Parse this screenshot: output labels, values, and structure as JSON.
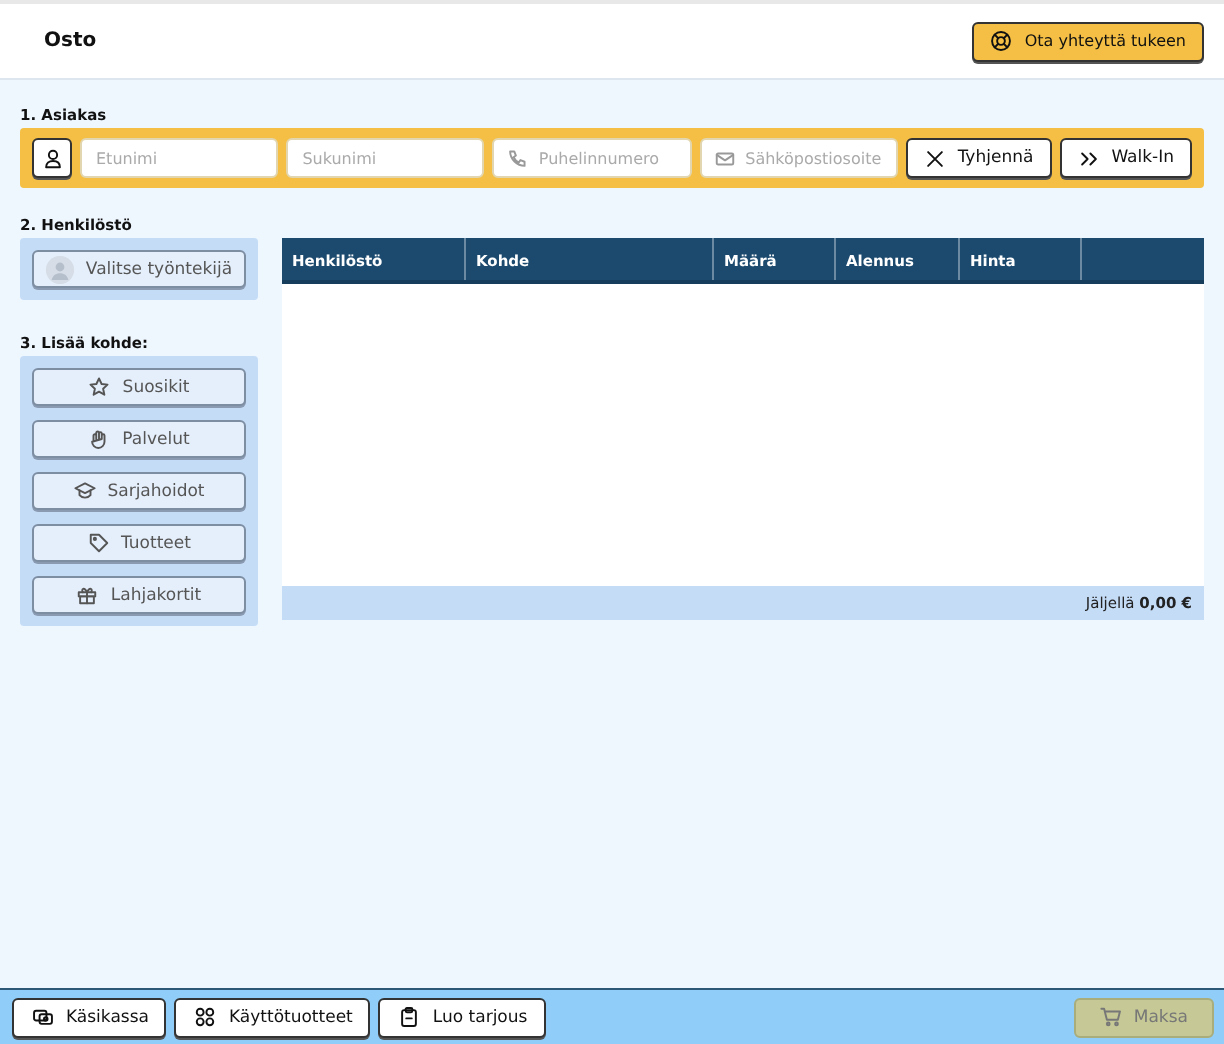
{
  "header": {
    "title": "Osto",
    "support_button": "Ota yhteyttä tukeen"
  },
  "customer": {
    "heading": "1. Asiakas",
    "fields": [
      {
        "placeholder": "Etunimi"
      },
      {
        "placeholder": "Sukunimi"
      },
      {
        "placeholder": "Puhelinnumero"
      },
      {
        "placeholder": "Sähköpostiosoite"
      }
    ],
    "buttons": [
      "Tyhjennä",
      "Walk-In"
    ]
  },
  "staff": {
    "heading": "2. Henkilöstö",
    "button": "Valitse työntekijä"
  },
  "add_item": {
    "heading": "3. Lisää kohde:",
    "buttons": [
      "Suosikit",
      "Palvelut",
      "Sarjahoidot",
      "Tuotteet",
      "Lahjakortit"
    ]
  },
  "table": {
    "columns": [
      "Henkilöstö",
      "Kohde",
      "Määrä",
      "Alennus",
      "Hinta"
    ],
    "footer": "Jäljellä **0,00 €**"
  },
  "footer_bar": {
    "buttons": [
      {
        "label": "Käsikassa",
        "disabled": false
      },
      {
        "label": "Käyttötuotteet",
        "disabled": false
      },
      {
        "label": "Luo tarjous",
        "disabled": false
      }
    ],
    "pay_button": {
      "label": "Maksa",
      "disabled": true
    }
  }
}
